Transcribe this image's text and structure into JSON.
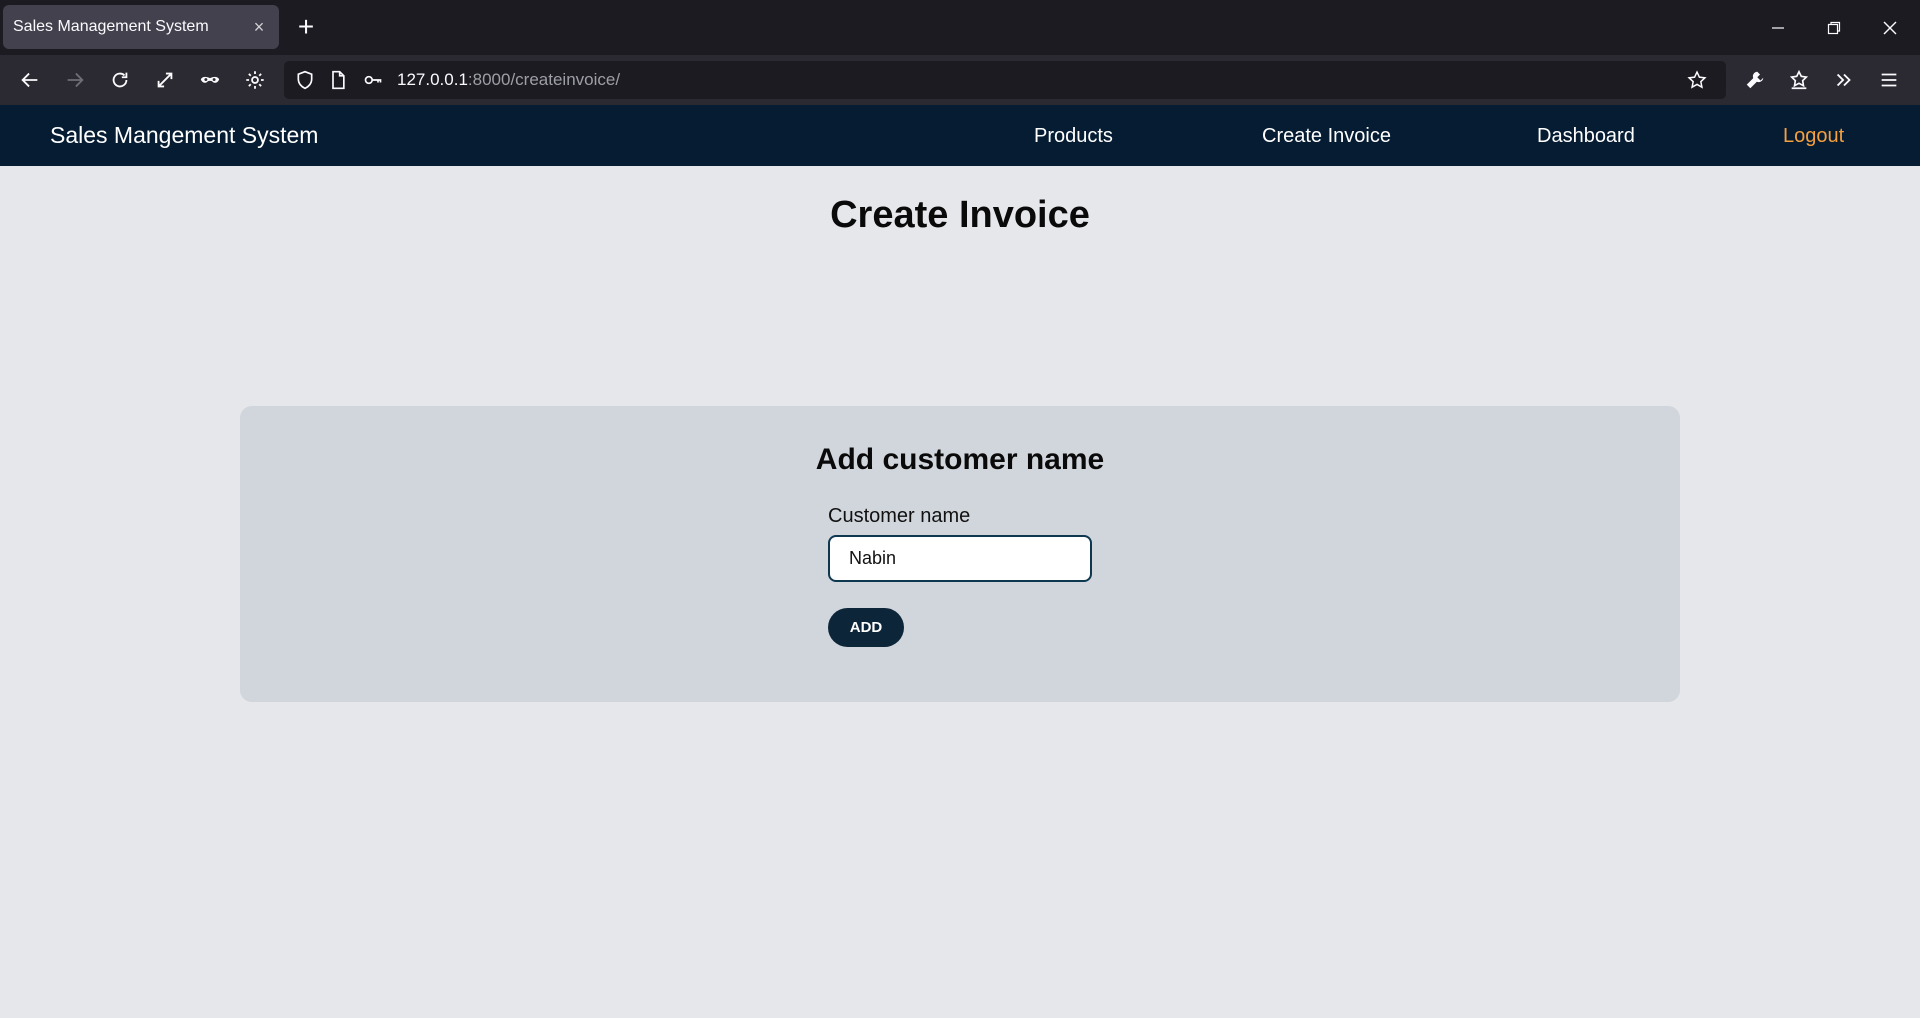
{
  "browser": {
    "tab_title": "Sales Management System",
    "tab_close": "×",
    "new_tab": "+",
    "url_host": "127.0.0.1",
    "url_path": ":8000/createinvoice/"
  },
  "navbar": {
    "brand": "Sales Mangement System",
    "links": [
      {
        "label": "Products"
      },
      {
        "label": "Create Invoice"
      },
      {
        "label": "Dashboard"
      },
      {
        "label": "Logout"
      }
    ],
    "background": "#051c33",
    "logout_color": "#f5a040"
  },
  "page": {
    "title": "Create Invoice"
  },
  "form": {
    "heading": "Add customer name",
    "field_label": "Customer name",
    "field_value": "Nabin",
    "button_label": "ADD"
  },
  "colors": {
    "page_background": "#e5e7eb",
    "card_background": "#d1d5dc",
    "button_background": "#0d2538"
  }
}
